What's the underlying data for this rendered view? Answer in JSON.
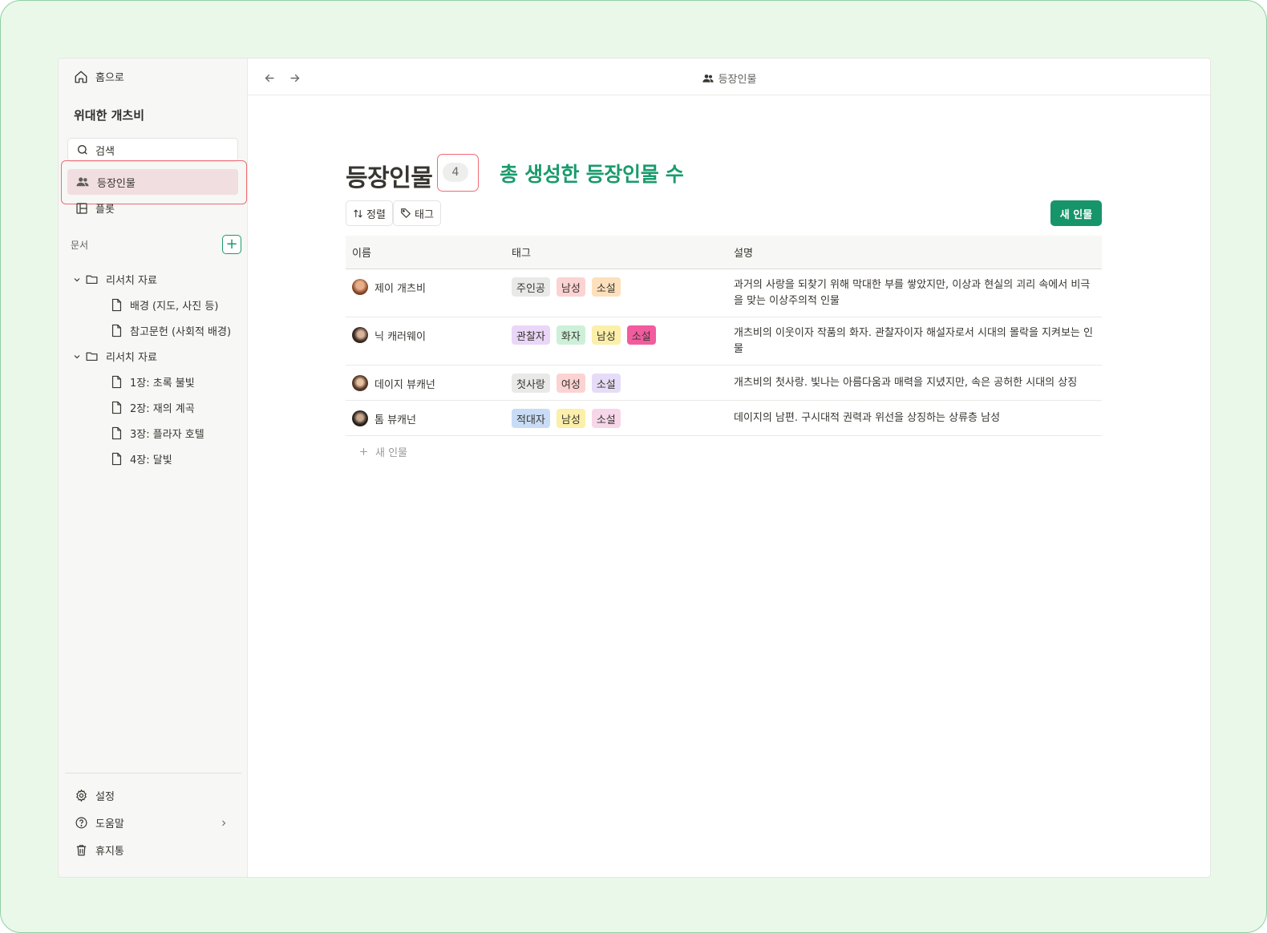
{
  "sidebar": {
    "home_label": "홈으로",
    "workspace_title": "위대한 개츠비",
    "search_placeholder": "검색",
    "nav": [
      {
        "label": "등장인물",
        "icon": "people-icon",
        "active": true
      },
      {
        "label": "플롯",
        "icon": "layout-icon",
        "active": false
      }
    ],
    "docs_label": "문서",
    "add_doc_label": "+",
    "tree": [
      {
        "label": "리서치 자료",
        "type": "folder",
        "level": 0
      },
      {
        "label": "배경 (지도, 사진 등)",
        "type": "doc",
        "level": 1
      },
      {
        "label": "참고문헌 (사회적 배경)",
        "type": "doc",
        "level": 1
      },
      {
        "label": "리서치 자료",
        "type": "folder",
        "level": 0
      },
      {
        "label": "1장: 초록 불빛",
        "type": "doc",
        "level": 1
      },
      {
        "label": "2장: 재의 계곡",
        "type": "doc",
        "level": 1
      },
      {
        "label": "3장: 플라자 호텔",
        "type": "doc",
        "level": 1
      },
      {
        "label": "4장: 달빛",
        "type": "doc",
        "level": 1
      }
    ],
    "bottom": [
      {
        "label": "설정",
        "icon": "gear-icon"
      },
      {
        "label": "도움말",
        "icon": "help-circle-icon"
      },
      {
        "label": "휴지통",
        "icon": "trash-icon"
      }
    ]
  },
  "topbar": {
    "breadcrumb": "등장인물"
  },
  "page": {
    "title": "등장인물",
    "count": "4",
    "annotation": "총 생성한 등장인물 수",
    "sort_label": "정렬",
    "tag_label": "태그",
    "new_button": "새 인물",
    "add_row_label": "새 인물"
  },
  "table": {
    "columns": [
      "이름",
      "태그",
      "설명"
    ],
    "rows": [
      {
        "name": "제이 개츠비",
        "tags": [
          {
            "label": "주인공",
            "color": "#e9e9e7"
          },
          {
            "label": "남성",
            "color": "#fbd3d3"
          },
          {
            "label": "소설",
            "color": "#fde0bc"
          }
        ],
        "desc": "과거의 사랑을 되찾기 위해 막대한 부를 쌓았지만, 이상과 현실의 괴리 속에서 비극을 맞는 이상주의적 인물"
      },
      {
        "name": "닉 캐러웨이",
        "tags": [
          {
            "label": "관찰자",
            "color": "#ead6f7"
          },
          {
            "label": "화자",
            "color": "#cdf0d9"
          },
          {
            "label": "남성",
            "color": "#fbefaa"
          },
          {
            "label": "소설",
            "color": "#f25c9f"
          }
        ],
        "desc": "개츠비의 이웃이자 작품의 화자. 관찰자이자 해설자로서 시대의 몰락을 지켜보는 인물"
      },
      {
        "name": "데이지 뷰캐넌",
        "tags": [
          {
            "label": "첫사랑",
            "color": "#e9e9e7"
          },
          {
            "label": "여성",
            "color": "#fbd3d3"
          },
          {
            "label": "소설",
            "color": "#e6dcf7"
          }
        ],
        "desc": "개츠비의 첫사랑. 빛나는 아름다움과 매력을 지녔지만, 속은 공허한 시대의 상징"
      },
      {
        "name": "톰 뷰캐넌",
        "tags": [
          {
            "label": "적대자",
            "color": "#c8dcf6"
          },
          {
            "label": "남성",
            "color": "#fbefaa"
          },
          {
            "label": "소설",
            "color": "#f7d6ea"
          }
        ],
        "desc": "데이지의 남편. 구시대적 권력과 위선을 상징하는 상류층 남성"
      }
    ]
  }
}
